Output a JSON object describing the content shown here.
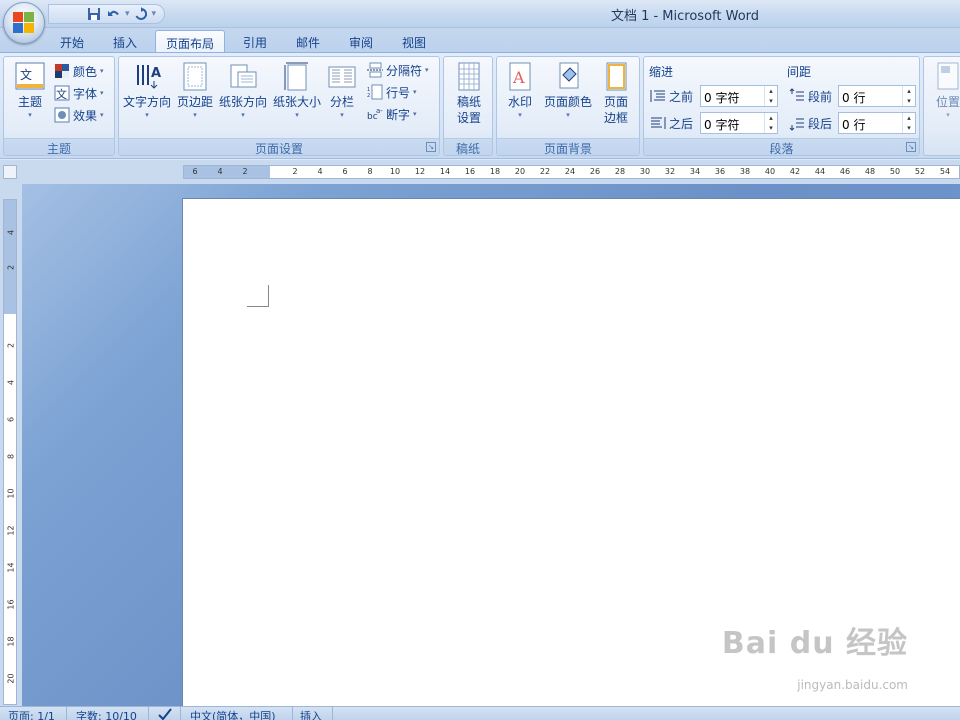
{
  "window": {
    "title": "文档 1 - Microsoft Word"
  },
  "qat": {
    "save": "save-icon",
    "undo": "undo-icon",
    "redo": "redo-icon",
    "customize": "▾"
  },
  "tabs": [
    "开始",
    "插入",
    "页面布局",
    "引用",
    "邮件",
    "审阅",
    "视图"
  ],
  "active_tab": "页面布局",
  "ribbon": {
    "themes": {
      "label": "主题",
      "btn": "主题",
      "colors": "颜色",
      "fonts": "字体",
      "effects": "效果"
    },
    "page_setup": {
      "label": "页面设置",
      "text_dir": "文字方向",
      "margins": "页边距",
      "orientation": "纸张方向",
      "size": "纸张大小",
      "columns": "分栏",
      "breaks": "分隔符",
      "line_numbers": "行号",
      "hyphenation": "断字"
    },
    "manuscript": {
      "label": "稿纸",
      "btn1": "稿纸",
      "btn2": "设置"
    },
    "page_bg": {
      "label": "页面背景",
      "watermark": "水印",
      "page_color": "页面颜色",
      "borders1": "页面",
      "borders2": "边框"
    },
    "paragraph": {
      "label": "段落",
      "indent": "缩进",
      "spacing": "间距",
      "before_l": "之前",
      "after_l": "之后",
      "before_val": "0 字符",
      "after_val": "0 字符",
      "sp_before": "段前",
      "sp_after": "段后",
      "sp_before_val": "0 行",
      "sp_after_val": "0 行"
    },
    "arrange": {
      "position": "位置"
    }
  },
  "hruler": [
    "6",
    "4",
    "2",
    "2",
    "4",
    "6",
    "8",
    "10",
    "12",
    "14",
    "16",
    "18",
    "20",
    "22",
    "24",
    "26",
    "28",
    "30",
    "32",
    "34",
    "36",
    "38",
    "40",
    "42",
    "44",
    "46",
    "48",
    "50",
    "52",
    "54"
  ],
  "vruler": [
    "4",
    "2",
    "2",
    "4",
    "6",
    "8",
    "10",
    "12",
    "14",
    "16",
    "18",
    "20"
  ],
  "status": {
    "page": "页面: 1/1",
    "words": "字数: 10/10",
    "language": "中文(简体，中国)",
    "mode": "插入"
  },
  "watermark": {
    "brand": "Bai du 经验",
    "url": "jingyan.baidu.com"
  },
  "colors": {
    "accent": "#15428b",
    "ribbon": "#dfe8f5",
    "workspace": "#7da3d4"
  }
}
